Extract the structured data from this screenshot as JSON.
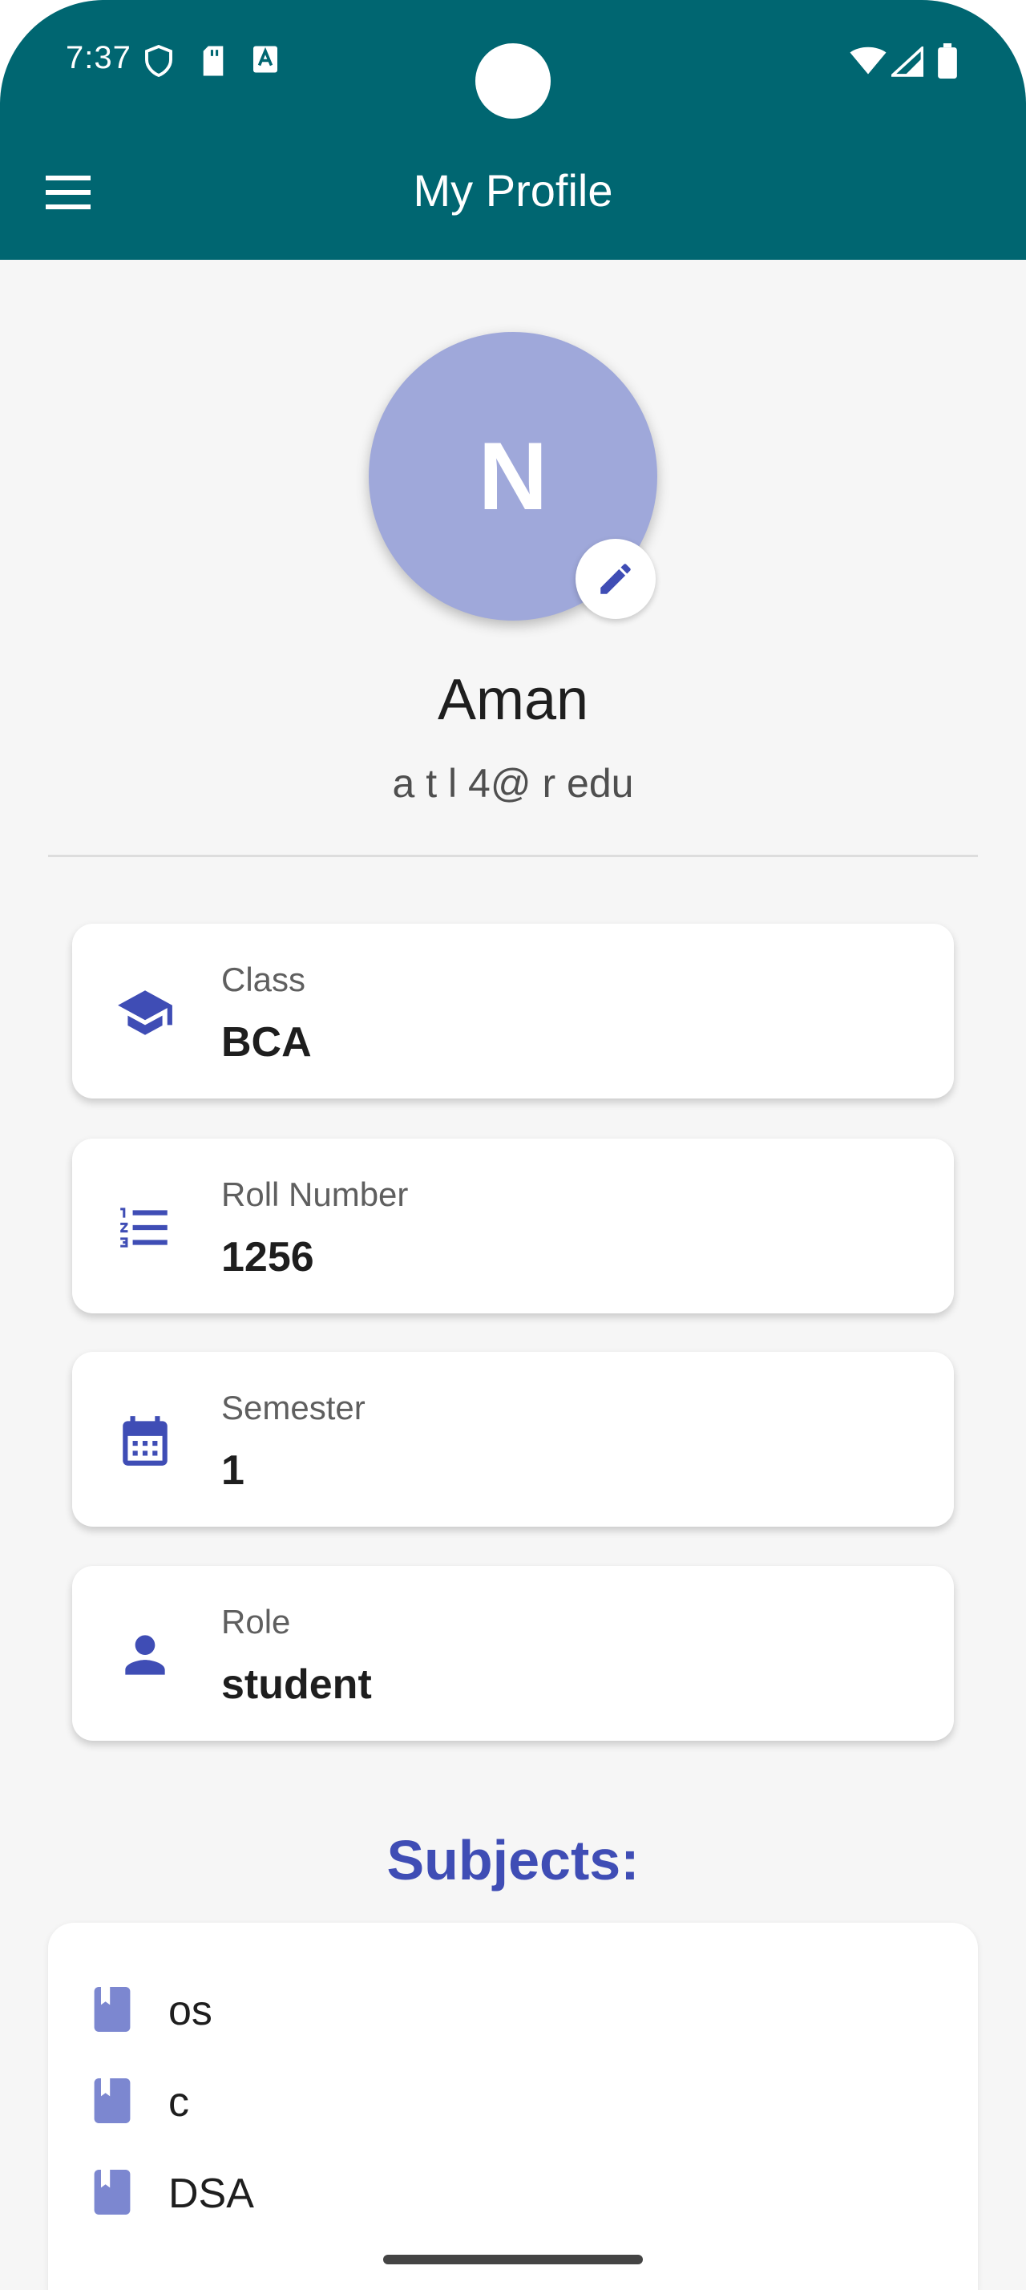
{
  "status_bar": {
    "time": "7:37",
    "icons": [
      "shield-icon",
      "sd-card-icon",
      "text-icon",
      "wifi-icon",
      "signal-icon",
      "battery-icon"
    ]
  },
  "app_bar": {
    "title": "My Profile",
    "menu_icon": "menu-icon",
    "background_color": "#006671"
  },
  "profile": {
    "avatar_letter": "N",
    "avatar_color": "#9fa8da",
    "name": "Aman",
    "email": "a t l 4@ r edu",
    "edit_icon": "edit-icon"
  },
  "info_cards": [
    {
      "icon": "school-icon",
      "label": "Class",
      "value": "BCA"
    },
    {
      "icon": "numbered-list-icon",
      "label": "Roll Number",
      "value": "1256"
    },
    {
      "icon": "calendar-icon",
      "label": "Semester",
      "value": "1"
    },
    {
      "icon": "person-icon",
      "label": "Role",
      "value": "student"
    }
  ],
  "subjects": {
    "heading": "Subjects:",
    "items": [
      {
        "icon": "book-icon",
        "name": "os"
      },
      {
        "icon": "book-icon",
        "name": "c"
      },
      {
        "icon": "book-icon",
        "name": "DSA"
      }
    ]
  },
  "accent_color": "#3f4db5"
}
